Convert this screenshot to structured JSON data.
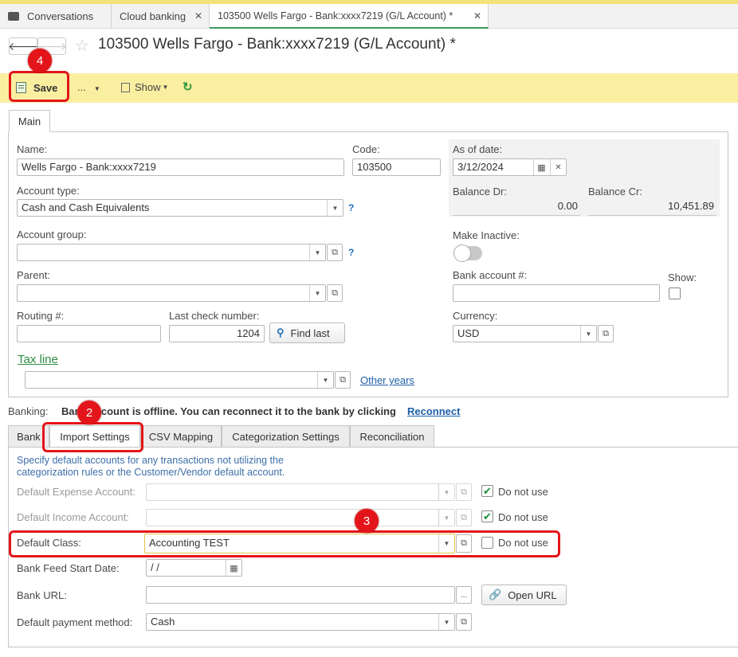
{
  "window_tabs": [
    {
      "label": "Conversations",
      "icon": "chat-icon"
    },
    {
      "label": "Cloud banking"
    },
    {
      "label": "103500 Wells Fargo - Bank:xxxx7219 (G/L Account) *"
    }
  ],
  "page_title": "103500 Wells Fargo - Bank:xxxx7219 (G/L Account) *",
  "toolbar": {
    "save_label": "Save",
    "more_label": "...",
    "show_label": "Show"
  },
  "callouts": {
    "save": "4",
    "import_tab": "2",
    "default_class": "3"
  },
  "main_tab": "Main",
  "form": {
    "name_label": "Name:",
    "name_value": "Wells Fargo - Bank:xxxx7219",
    "code_label": "Code:",
    "code_value": "103500",
    "as_of_label": "As of date:",
    "as_of_value": "3/12/2024",
    "account_type_label": "Account type:",
    "account_type_value": "Cash and Cash Equivalents",
    "balance_dr_label": "Balance Dr:",
    "balance_dr_value": "0.00",
    "balance_cr_label": "Balance Cr:",
    "balance_cr_value": "10,451.89",
    "account_group_label": "Account group:",
    "account_group_value": "",
    "make_inactive_label": "Make Inactive:",
    "parent_label": "Parent:",
    "parent_value": "",
    "bank_account_label": "Bank account #:",
    "bank_account_value": "",
    "show_label": "Show:",
    "routing_label": "Routing #:",
    "routing_value": "",
    "last_check_label": "Last check number:",
    "last_check_value": "1204",
    "find_last_label": "Find last",
    "currency_label": "Currency:",
    "currency_value": "USD",
    "tax_line_label": "Tax line",
    "tax_line_value": "",
    "other_years_label": "Other years",
    "help_mark": "?"
  },
  "banking": {
    "label": "Banking:",
    "message": "Bank account is offline. You can reconnect it to the bank by clicking",
    "reconnect": "Reconnect"
  },
  "sub_tabs": [
    "Bank",
    "Import Settings",
    "CSV Mapping",
    "Categorization Settings",
    "Reconciliation"
  ],
  "import_settings": {
    "info_line1": "Specify default accounts for any transactions not utilizing the",
    "info_line2": "categorization rules or the Customer/Vendor default account.",
    "default_expense_label": "Default Expense Account:",
    "default_income_label": "Default Income Account:",
    "default_class_label": "Default Class:",
    "default_class_value": "Accounting TEST",
    "do_not_use_label": "Do not use",
    "bank_feed_label": "Bank Feed Start Date:",
    "bank_feed_value": " /  /",
    "bank_url_label": "Bank URL:",
    "bank_url_value": "",
    "open_url_label": "Open URL",
    "payment_method_label": "Default payment method:",
    "payment_method_value": "Cash",
    "ellipsis": "..."
  }
}
